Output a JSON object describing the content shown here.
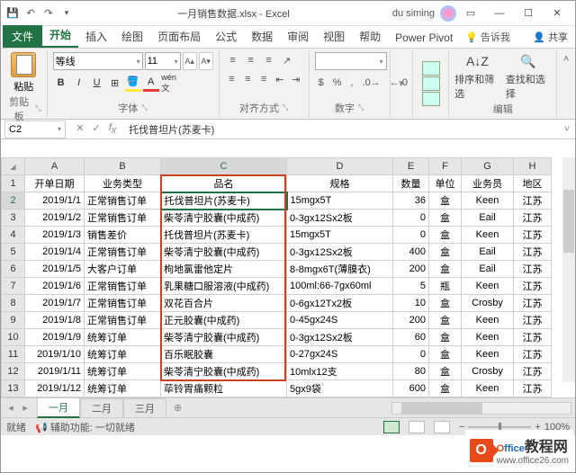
{
  "title": {
    "filename": "一月销售数据.xlsx",
    "app": "Excel",
    "sep": " - "
  },
  "user": {
    "name": "du siming"
  },
  "tabs": {
    "file": "文件",
    "home": "开始",
    "insert": "插入",
    "draw": "绘图",
    "layout": "页面布局",
    "formulas": "公式",
    "data": "数据",
    "review": "审阅",
    "view": "视图",
    "help": "帮助",
    "powerpivot": "Power Pivot",
    "tell": "告诉我",
    "share": "共享"
  },
  "ribbon": {
    "clipboard": {
      "paste": "粘贴",
      "group": "剪贴板"
    },
    "font": {
      "name": "等线",
      "size": "11",
      "group": "字体"
    },
    "align": {
      "group": "对齐方式"
    },
    "number": {
      "format": "",
      "group": "数字"
    },
    "styles": {
      "group": ""
    },
    "cells": {
      "group": ""
    },
    "edit": {
      "sort": "排序和筛选",
      "find": "查找和选择",
      "group": "编辑"
    }
  },
  "namebox": "C2",
  "formula": "托伐普坦片(苏麦卡)",
  "cols": [
    "",
    "A",
    "B",
    "C",
    "D",
    "E",
    "F",
    "G",
    "H"
  ],
  "headers": {
    "A": "开单日期",
    "B": "业务类型",
    "C": "品名",
    "D": "规格",
    "E": "数量",
    "F": "单位",
    "G": "业务员",
    "H": "地区"
  },
  "rows": [
    {
      "n": 2,
      "A": "2019/1/1",
      "B": "正常销售订单",
      "C": "托伐普坦片(苏麦卡)",
      "D": "15mgx5T",
      "E": "36",
      "F": "盒",
      "G": "Keen",
      "H": "江苏"
    },
    {
      "n": 3,
      "A": "2019/1/2",
      "B": "正常销售订单",
      "C": "柴苓清宁胶囊(中成药)",
      "D": "0-3gx12Sx2板",
      "E": "0",
      "F": "盒",
      "G": "Eail",
      "H": "江苏"
    },
    {
      "n": 4,
      "A": "2019/1/3",
      "B": "销售差价",
      "C": "托伐普坦片(苏麦卡)",
      "D": "15mgx5T",
      "E": "0",
      "F": "盒",
      "G": "Keen",
      "H": "江苏"
    },
    {
      "n": 5,
      "A": "2019/1/4",
      "B": "正常销售订单",
      "C": "柴苓清宁胶囊(中成药)",
      "D": "0-3gx12Sx2板",
      "E": "400",
      "F": "盒",
      "G": "Eail",
      "H": "江苏"
    },
    {
      "n": 6,
      "A": "2019/1/5",
      "B": "大客户订单",
      "C": "枸地氯雷他定片",
      "D": "8-8mgx6T(薄膜衣)",
      "E": "200",
      "F": "盒",
      "G": "Eail",
      "H": "江苏"
    },
    {
      "n": 7,
      "A": "2019/1/6",
      "B": "正常销售订单",
      "C": "乳果糖口服溶液(中成药)",
      "D": "100ml:66-7gx60ml",
      "E": "5",
      "F": "瓶",
      "G": "Keen",
      "H": "江苏"
    },
    {
      "n": 8,
      "A": "2019/1/7",
      "B": "正常销售订单",
      "C": "双花百合片",
      "D": "0-6gx12Tx2板",
      "E": "10",
      "F": "盒",
      "G": "Crosby",
      "H": "江苏"
    },
    {
      "n": 9,
      "A": "2019/1/8",
      "B": "正常销售订单",
      "C": "正元胶囊(中成药)",
      "D": "0-45gx24S",
      "E": "200",
      "F": "盒",
      "G": "Keen",
      "H": "江苏"
    },
    {
      "n": 10,
      "A": "2019/1/9",
      "B": "统筹订单",
      "C": "柴苓清宁胶囊(中成药)",
      "D": "0-3gx12Sx2板",
      "E": "60",
      "F": "盒",
      "G": "Keen",
      "H": "江苏"
    },
    {
      "n": 11,
      "A": "2019/1/10",
      "B": "统筹订单",
      "C": "百乐眠胶囊",
      "D": "0-27gx24S",
      "E": "0",
      "F": "盒",
      "G": "Keen",
      "H": "江苏"
    },
    {
      "n": 12,
      "A": "2019/1/11",
      "B": "统筹订单",
      "C": "柴苓清宁胶囊(中成药)",
      "D": "10mlx12支",
      "E": "80",
      "F": "盒",
      "G": "Crosby",
      "H": "江苏"
    },
    {
      "n": 13,
      "A": "2019/1/12",
      "B": "统筹订单",
      "C": "荜铃胃痛颗粒",
      "D": "5gx9袋",
      "E": "600",
      "F": "盒",
      "G": "Keen",
      "H": "江苏"
    }
  ],
  "sheets": {
    "jan": "一月",
    "feb": "二月",
    "mar": "三月"
  },
  "status": {
    "ready": "就绪",
    "acc": "辅助功能: 一切就绪",
    "zoom": "100%"
  },
  "watermark": {
    "brand1": "O",
    "brand2": "ffice",
    "site": "教程网",
    "url": "www.office26.com"
  }
}
